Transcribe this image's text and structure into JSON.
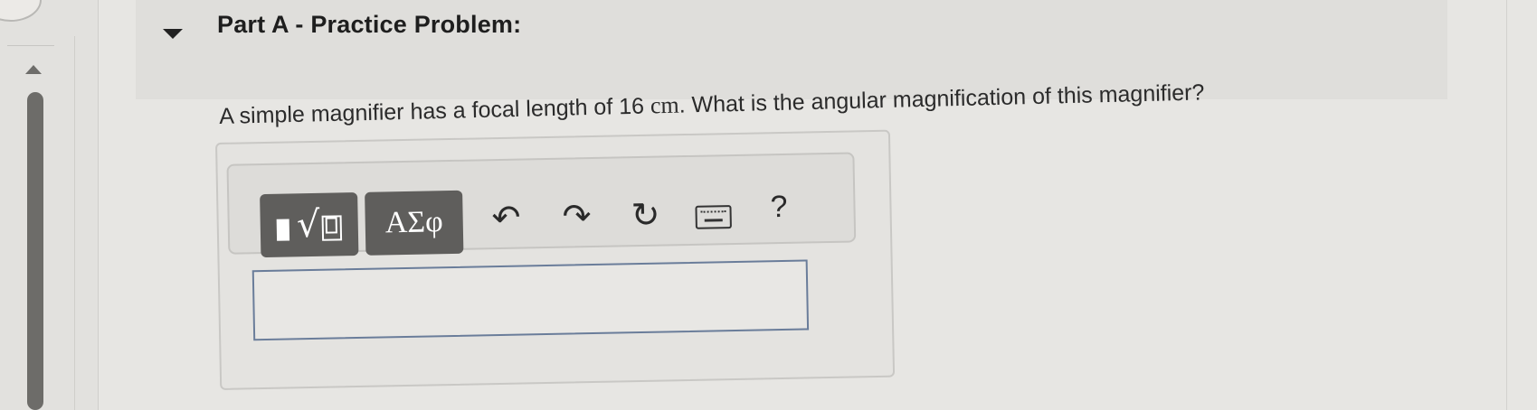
{
  "part": {
    "title": "Part A - Practice Problem:",
    "expanded": true
  },
  "problem": {
    "text_before": "A simple magnifier has a focal length of 16 ",
    "unit": "cm",
    "text_after": ". What is the angular magnification of this magnifier?"
  },
  "toolbar": {
    "templates_icon": "templates-root-icon",
    "greek_label": "ΑΣφ",
    "undo_icon": "↶",
    "redo_icon": "↷",
    "reset_icon": "↻",
    "keyboard_icon": "keyboard-icon",
    "help_label": "?"
  },
  "answer": {
    "value": ""
  },
  "colors": {
    "page_bg": "#e7e6e3",
    "header_bg": "#dfdedb",
    "toolbar_button": "#5f5e5c",
    "input_border": "#6a7d9a"
  }
}
